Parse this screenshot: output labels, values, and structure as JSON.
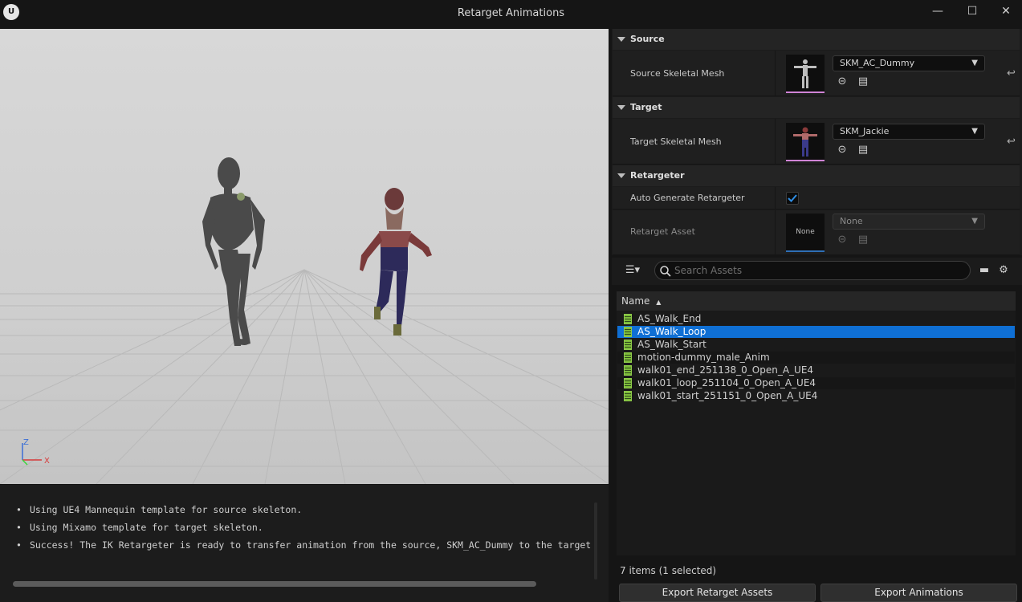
{
  "window": {
    "title": "Retarget Animations",
    "logo_glyph": "U",
    "minimize_glyph": "—",
    "maximize_glyph": "☐",
    "close_glyph": "✕"
  },
  "viewport": {
    "axis_z": "Z",
    "axis_x": "X"
  },
  "log": {
    "lines": [
      "Using UE4 Mannequin template for source skeleton.",
      "Using Mixamo template for target skeleton.",
      "Success! The IK Retargeter is ready to transfer animation from the source, SKM_AC_Dummy to the target"
    ]
  },
  "details": {
    "source": {
      "category": "Source",
      "label": "Source Skeletal Mesh",
      "value": "SKM_AC_Dummy"
    },
    "target": {
      "category": "Target",
      "label": "Target Skeletal Mesh",
      "value": "SKM_Jackie"
    },
    "retargeter": {
      "category": "Retargeter",
      "auto_label": "Auto Generate Retargeter",
      "auto_checked": true,
      "asset_label": "Retarget Asset",
      "asset_value": "None",
      "asset_thumb_text": "None"
    }
  },
  "browser": {
    "search_placeholder": "Search Assets",
    "column_name": "Name",
    "assets": [
      "AS_Walk_End",
      "AS_Walk_Loop",
      "AS_Walk_Start",
      "motion-dummy_male_Anim",
      "walk01_end_251138_0_Open_A_UE4",
      "walk01_loop_251104_0_Open_A_UE4",
      "walk01_start_251151_0_Open_A_UE4"
    ],
    "selected_index": 1,
    "status": "7 items (1 selected)",
    "export_retarget_label": "Export Retarget Assets",
    "export_anim_label": "Export Animations"
  },
  "icons": {
    "dropdown": "chevron-down-icon",
    "browse": "browse-arrow-icon",
    "find": "folder-search-icon",
    "reset": "reset-arrow-icon",
    "filter": "filter-icon",
    "search": "search-icon",
    "folder": "folder-icon",
    "settings": "gear-icon"
  },
  "colors": {
    "selection": "#0f6fd4",
    "thumb_underline": "#d083d6",
    "asset_icon": "#7dbb3a"
  }
}
